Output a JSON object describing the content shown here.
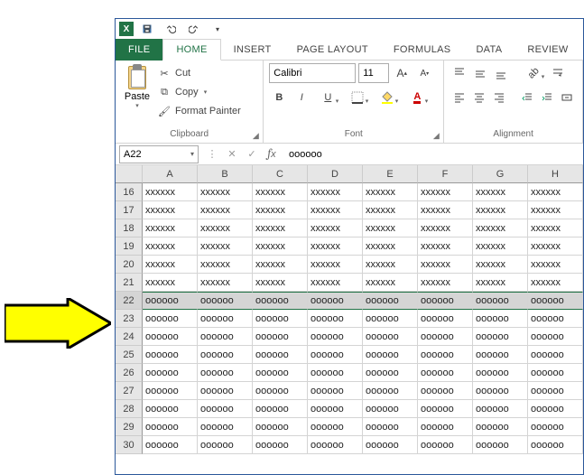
{
  "qat": {
    "save": "💾",
    "undo": "↶",
    "redo": "↷"
  },
  "tabs": {
    "file": "FILE",
    "home": "HOME",
    "insert": "INSERT",
    "pagelayout": "PAGE LAYOUT",
    "formulas": "FORMULAS",
    "data": "DATA",
    "review": "REVIEW"
  },
  "clipboard": {
    "paste": "Paste",
    "cut": "Cut",
    "copy": "Copy",
    "formatpainter": "Format Painter",
    "label": "Clipboard"
  },
  "font": {
    "name": "Calibri",
    "size": "11",
    "bold": "B",
    "italic": "I",
    "underline": "U",
    "label": "Font"
  },
  "alignment": {
    "label": "Alignment"
  },
  "namebox": "A22",
  "formula_value": "oooooo",
  "columns": [
    "A",
    "B",
    "C",
    "D",
    "E",
    "F",
    "G",
    "H"
  ],
  "rows": [
    {
      "n": "16",
      "v": [
        "xxxxxx",
        "xxxxxx",
        "xxxxxx",
        "xxxxxx",
        "xxxxxx",
        "xxxxxx",
        "xxxxxx",
        "xxxxxx"
      ]
    },
    {
      "n": "17",
      "v": [
        "xxxxxx",
        "xxxxxx",
        "xxxxxx",
        "xxxxxx",
        "xxxxxx",
        "xxxxxx",
        "xxxxxx",
        "xxxxxx"
      ]
    },
    {
      "n": "18",
      "v": [
        "xxxxxx",
        "xxxxxx",
        "xxxxxx",
        "xxxxxx",
        "xxxxxx",
        "xxxxxx",
        "xxxxxx",
        "xxxxxx"
      ]
    },
    {
      "n": "19",
      "v": [
        "xxxxxx",
        "xxxxxx",
        "xxxxxx",
        "xxxxxx",
        "xxxxxx",
        "xxxxxx",
        "xxxxxx",
        "xxxxxx"
      ]
    },
    {
      "n": "20",
      "v": [
        "xxxxxx",
        "xxxxxx",
        "xxxxxx",
        "xxxxxx",
        "xxxxxx",
        "xxxxxx",
        "xxxxxx",
        "xxxxxx"
      ]
    },
    {
      "n": "21",
      "v": [
        "xxxxxx",
        "xxxxxx",
        "xxxxxx",
        "xxxxxx",
        "xxxxxx",
        "xxxxxx",
        "xxxxxx",
        "xxxxxx"
      ]
    },
    {
      "n": "22",
      "sel": true,
      "v": [
        "oooooo",
        "oooooo",
        "oooooo",
        "oooooo",
        "oooooo",
        "oooooo",
        "oooooo",
        "oooooo"
      ]
    },
    {
      "n": "23",
      "v": [
        "oooooo",
        "oooooo",
        "oooooo",
        "oooooo",
        "oooooo",
        "oooooo",
        "oooooo",
        "oooooo"
      ]
    },
    {
      "n": "24",
      "v": [
        "oooooo",
        "oooooo",
        "oooooo",
        "oooooo",
        "oooooo",
        "oooooo",
        "oooooo",
        "oooooo"
      ]
    },
    {
      "n": "25",
      "v": [
        "oooooo",
        "oooooo",
        "oooooo",
        "oooooo",
        "oooooo",
        "oooooo",
        "oooooo",
        "oooooo"
      ]
    },
    {
      "n": "26",
      "v": [
        "oooooo",
        "oooooo",
        "oooooo",
        "oooooo",
        "oooooo",
        "oooooo",
        "oooooo",
        "oooooo"
      ]
    },
    {
      "n": "27",
      "v": [
        "oooooo",
        "oooooo",
        "oooooo",
        "oooooo",
        "oooooo",
        "oooooo",
        "oooooo",
        "oooooo"
      ]
    },
    {
      "n": "28",
      "v": [
        "oooooo",
        "oooooo",
        "oooooo",
        "oooooo",
        "oooooo",
        "oooooo",
        "oooooo",
        "oooooo"
      ]
    },
    {
      "n": "29",
      "v": [
        "oooooo",
        "oooooo",
        "oooooo",
        "oooooo",
        "oooooo",
        "oooooo",
        "oooooo",
        "oooooo"
      ]
    },
    {
      "n": "30",
      "v": [
        "oooooo",
        "oooooo",
        "oooooo",
        "oooooo",
        "oooooo",
        "oooooo",
        "oooooo",
        "oooooo"
      ]
    }
  ]
}
